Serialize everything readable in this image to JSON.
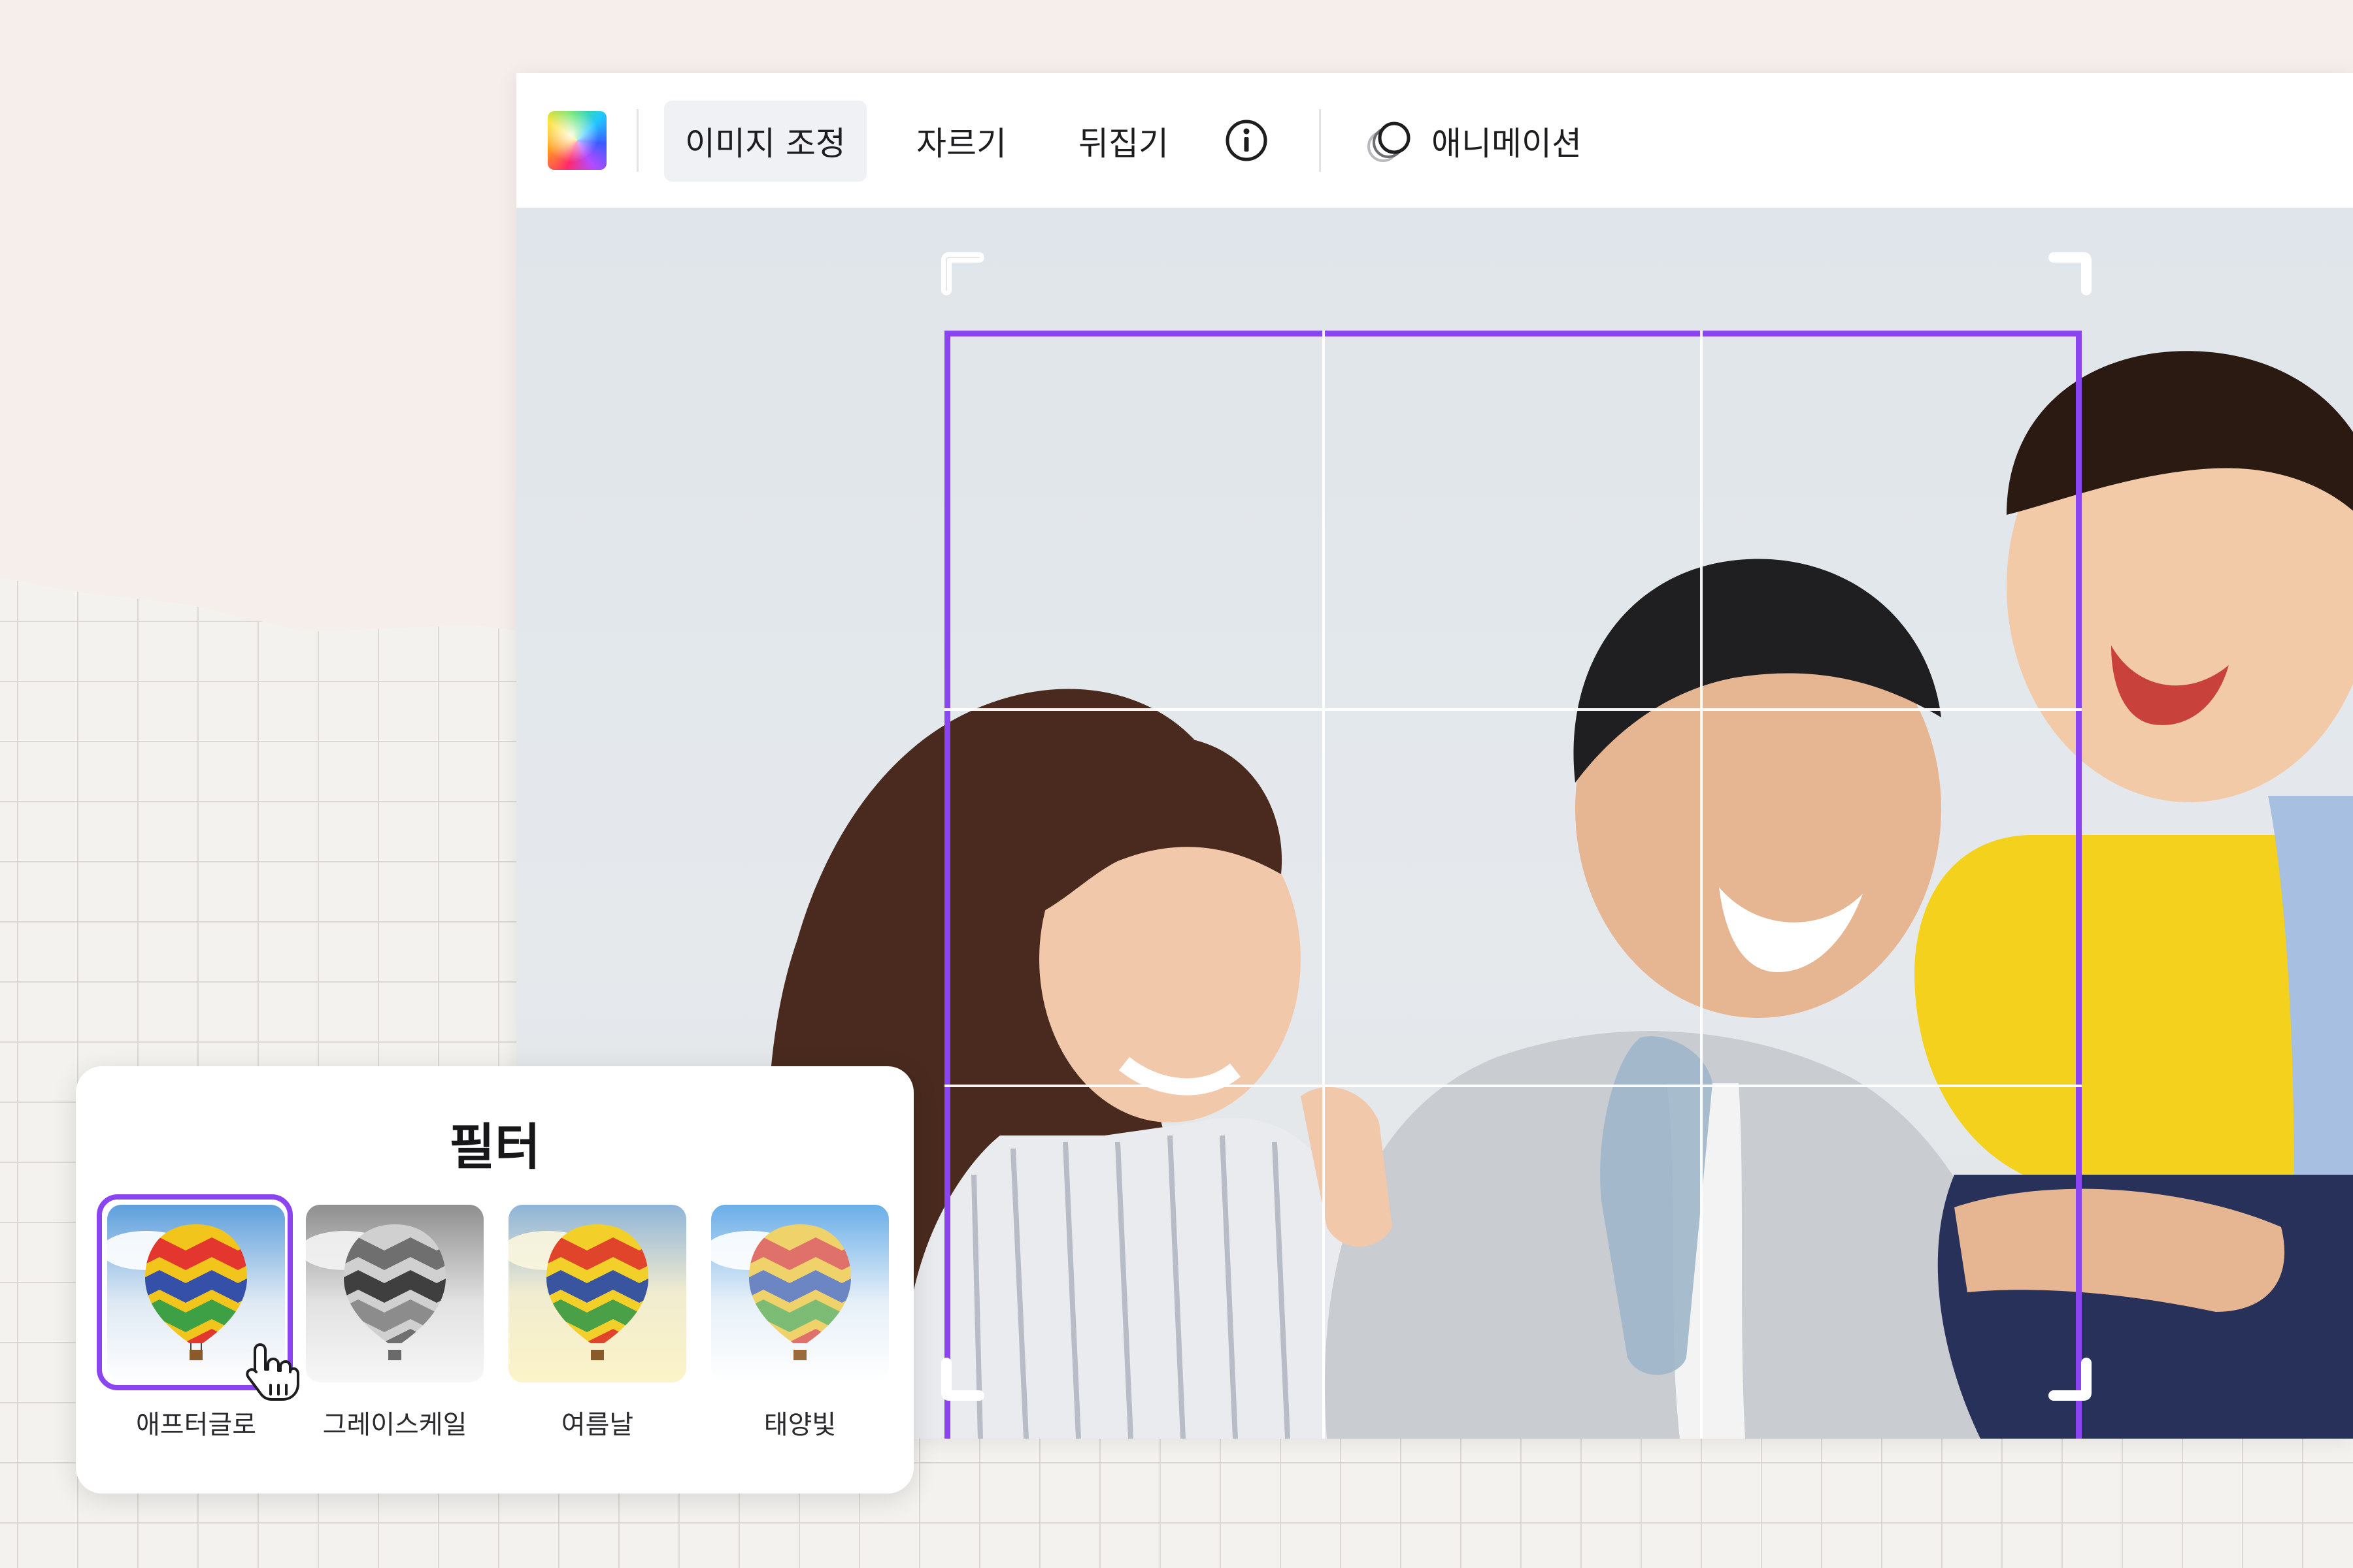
{
  "toolbar": {
    "color_icon": "color-picker-icon",
    "adjust_label": "이미지 조정",
    "crop_label": "자르기",
    "flip_label": "뒤집기",
    "info_icon": "info-icon",
    "animation_icon": "animation-icon",
    "animation_label": "애니메이션"
  },
  "crop": {
    "accent": "#8b45f0",
    "grid": "3x3"
  },
  "filters": {
    "title": "필터",
    "items": [
      {
        "label": "애프터글로",
        "style": "afterglow",
        "selected": true
      },
      {
        "label": "그레이스케일",
        "style": "grayscale",
        "selected": false
      },
      {
        "label": "여름날",
        "style": "summer-day",
        "selected": false
      },
      {
        "label": "태양빛",
        "style": "sunlight",
        "selected": false
      }
    ]
  },
  "colors": {
    "accent": "#8b45f0",
    "toolbar_active": "#f0f1f4"
  }
}
